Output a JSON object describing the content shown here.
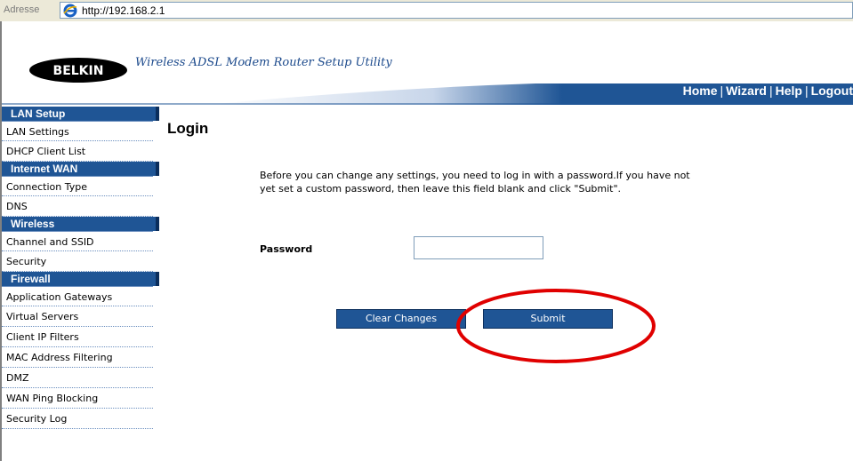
{
  "browser": {
    "address_label": "Adresse",
    "url": "http://192.168.2.1"
  },
  "header": {
    "logo_text": "BELKIN",
    "title": "Wireless ADSL Modem Router Setup Utility",
    "nav": [
      "Home",
      "Wizard",
      "Help",
      "Logout"
    ]
  },
  "sidebar": {
    "sections": [
      {
        "title": "LAN Setup",
        "items": [
          "LAN Settings",
          "DHCP Client List"
        ]
      },
      {
        "title": "Internet WAN",
        "items": [
          "Connection Type",
          "DNS"
        ]
      },
      {
        "title": "Wireless",
        "items": [
          "Channel and SSID",
          "Security"
        ]
      },
      {
        "title": "Firewall",
        "items": [
          "Application Gateways",
          "Virtual Servers",
          "Client IP Filters",
          "MAC Address Filtering",
          "DMZ",
          "WAN Ping Blocking",
          "Security Log"
        ]
      }
    ]
  },
  "main": {
    "heading": "Login",
    "intro": "Before you can change any settings, you need to log in with a password.If you have not yet set a custom password, then leave this field blank and click \"Submit\".",
    "password_label": "Password",
    "password_value": "",
    "clear_button": "Clear Changes",
    "submit_button": "Submit"
  },
  "colors": {
    "nav_blue": "#1f5595",
    "highlight_red": "#e00000"
  },
  "icons": [
    "internet-explorer-icon",
    "belkin-logo"
  ]
}
